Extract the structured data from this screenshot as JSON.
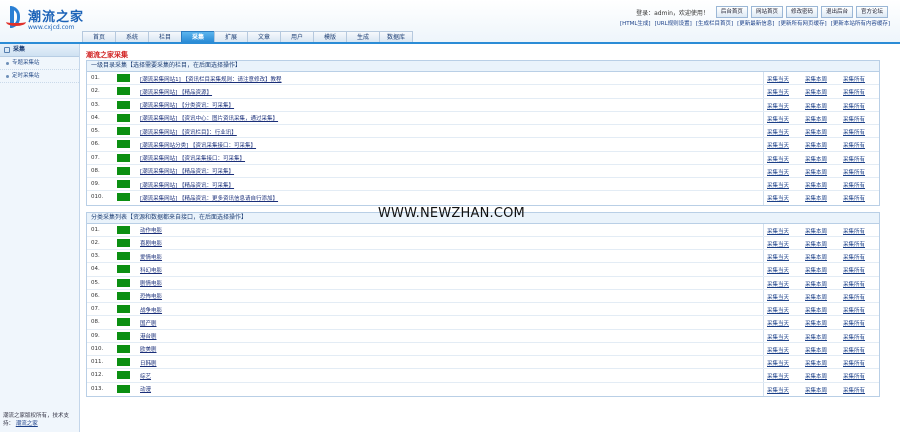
{
  "logo": {
    "name": "潮流之家",
    "url": "www.cxjcd.com"
  },
  "topbar": {
    "user_text": "登录：admin，欢迎使用！",
    "buttons": [
      "后台首页",
      "网站首页",
      "修改密码",
      "退出后台",
      "官方论坛"
    ]
  },
  "quicklinks": [
    "[HTML生成]",
    "[URL规则设置]",
    "[生成栏目首页]",
    "[更新最新信息]",
    "[更新所有网页缓存]",
    "[更新本站所有内容缓存]"
  ],
  "nav": {
    "tabs": [
      "首页",
      "系统",
      "栏目",
      "采集",
      "扩展",
      "文章",
      "用户",
      "模版",
      "生成",
      "数据库"
    ],
    "active": 3
  },
  "sidebar": {
    "title": "采集",
    "items": [
      "专题采集站",
      "定时采集站"
    ],
    "footer_text": "潮流之家版权所有，技术支持：",
    "footer_link": "潮流之家"
  },
  "main": {
    "title": "潮流之家采集",
    "section1": {
      "header": "一级目录采集【选择需要采集的栏目，在后面选择操作】",
      "rows": [
        {
          "num": "01.",
          "name": "[潮流采集网站1] 【资讯栏目采集规则：请注意修改】教程"
        },
        {
          "num": "02.",
          "name": "[潮流采集网站] 【精品资源】"
        },
        {
          "num": "03.",
          "name": "[潮流采集网站] 【分类资讯：可采集】"
        },
        {
          "num": "04.",
          "name": "[潮流采集网站] 【资讯中心：图片资讯采集，通过采集】"
        },
        {
          "num": "05.",
          "name": "[潮流采集网站] 【资讯栏目】：行业讯】"
        },
        {
          "num": "06.",
          "name": "[潮流采集网站分类] 【资讯采集接口：可采集】"
        },
        {
          "num": "07.",
          "name": "[潮流采集网站] 【资讯采集接口：可采集】"
        },
        {
          "num": "08.",
          "name": "[潮流采集网站] 【精品资讯：可采集】"
        },
        {
          "num": "09.",
          "name": "[潮流采集网站] 【精品资讯：可采集】"
        },
        {
          "num": "010.",
          "name": "[潮流采集网站] 【精品资讯：更多资讯信息请自行添加】"
        }
      ]
    },
    "section2": {
      "header": "分类采集列表【资源和数据都来自接口，在后面选择操作】",
      "rows": [
        {
          "num": "01.",
          "name": "动作电影"
        },
        {
          "num": "02.",
          "name": "喜剧电影"
        },
        {
          "num": "03.",
          "name": "爱情电影"
        },
        {
          "num": "04.",
          "name": "科幻电影"
        },
        {
          "num": "05.",
          "name": "剧情电影"
        },
        {
          "num": "06.",
          "name": "恐怖电影"
        },
        {
          "num": "07.",
          "name": "战争电影"
        },
        {
          "num": "08.",
          "name": "国产剧"
        },
        {
          "num": "09.",
          "name": "港台剧"
        },
        {
          "num": "010.",
          "name": "欧美剧"
        },
        {
          "num": "011.",
          "name": "日韩剧"
        },
        {
          "num": "012.",
          "name": "综艺"
        },
        {
          "num": "013.",
          "name": "动漫"
        }
      ]
    },
    "actions": [
      "采集当天",
      "采集本周",
      "采集所有"
    ]
  },
  "watermark": "WWW.NEWZHAN.COM",
  "colors": {
    "accent": "#2b8cd6",
    "title_red": "#d12020",
    "status_green": "#0b8f12"
  }
}
